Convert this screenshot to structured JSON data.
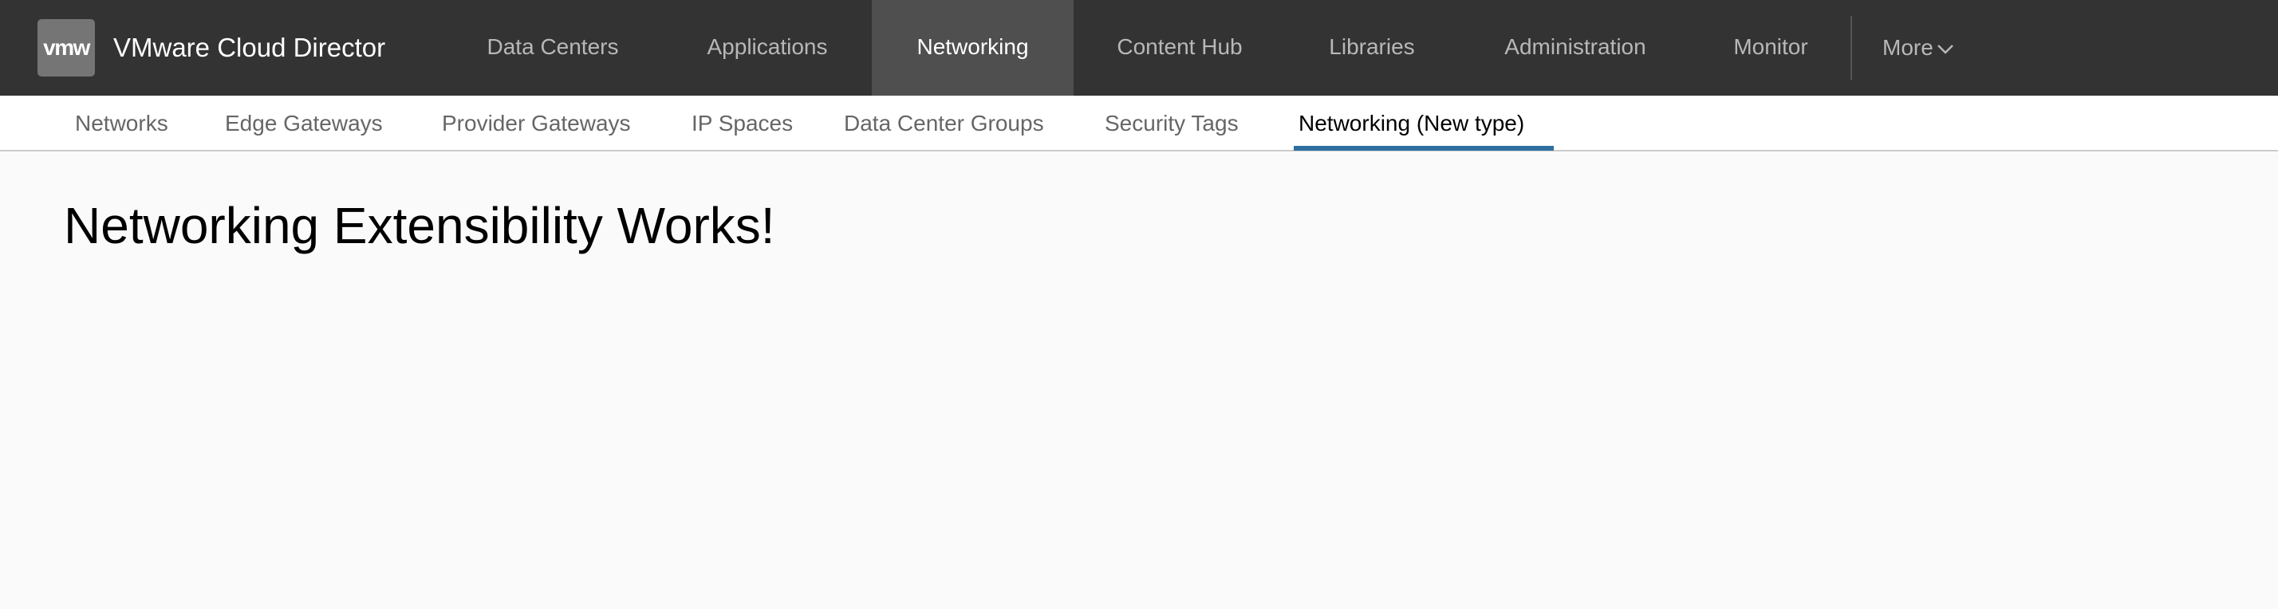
{
  "header": {
    "logo_text": "vmw",
    "app_title": "VMware Cloud Director",
    "nav": [
      {
        "label": "Data Centers",
        "active": false
      },
      {
        "label": "Applications",
        "active": false
      },
      {
        "label": "Networking",
        "active": true
      },
      {
        "label": "Content Hub",
        "active": false
      },
      {
        "label": "Libraries",
        "active": false
      },
      {
        "label": "Administration",
        "active": false
      },
      {
        "label": "Monitor",
        "active": false
      }
    ],
    "more_label": "More",
    "more_icon": "chevron-down-icon"
  },
  "subnav": {
    "tabs": [
      {
        "label": "Networks",
        "active": false
      },
      {
        "label": "Edge Gateways",
        "active": false
      },
      {
        "label": "Provider Gateways",
        "active": false
      },
      {
        "label": "IP Spaces",
        "active": false
      },
      {
        "label": "Data Center Groups",
        "active": false
      },
      {
        "label": "Security Tags",
        "active": false
      },
      {
        "label": "Networking (New type)",
        "active": true
      }
    ],
    "active_color": "#2f6f9f"
  },
  "main": {
    "title": "Networking Extensibility Works!"
  }
}
